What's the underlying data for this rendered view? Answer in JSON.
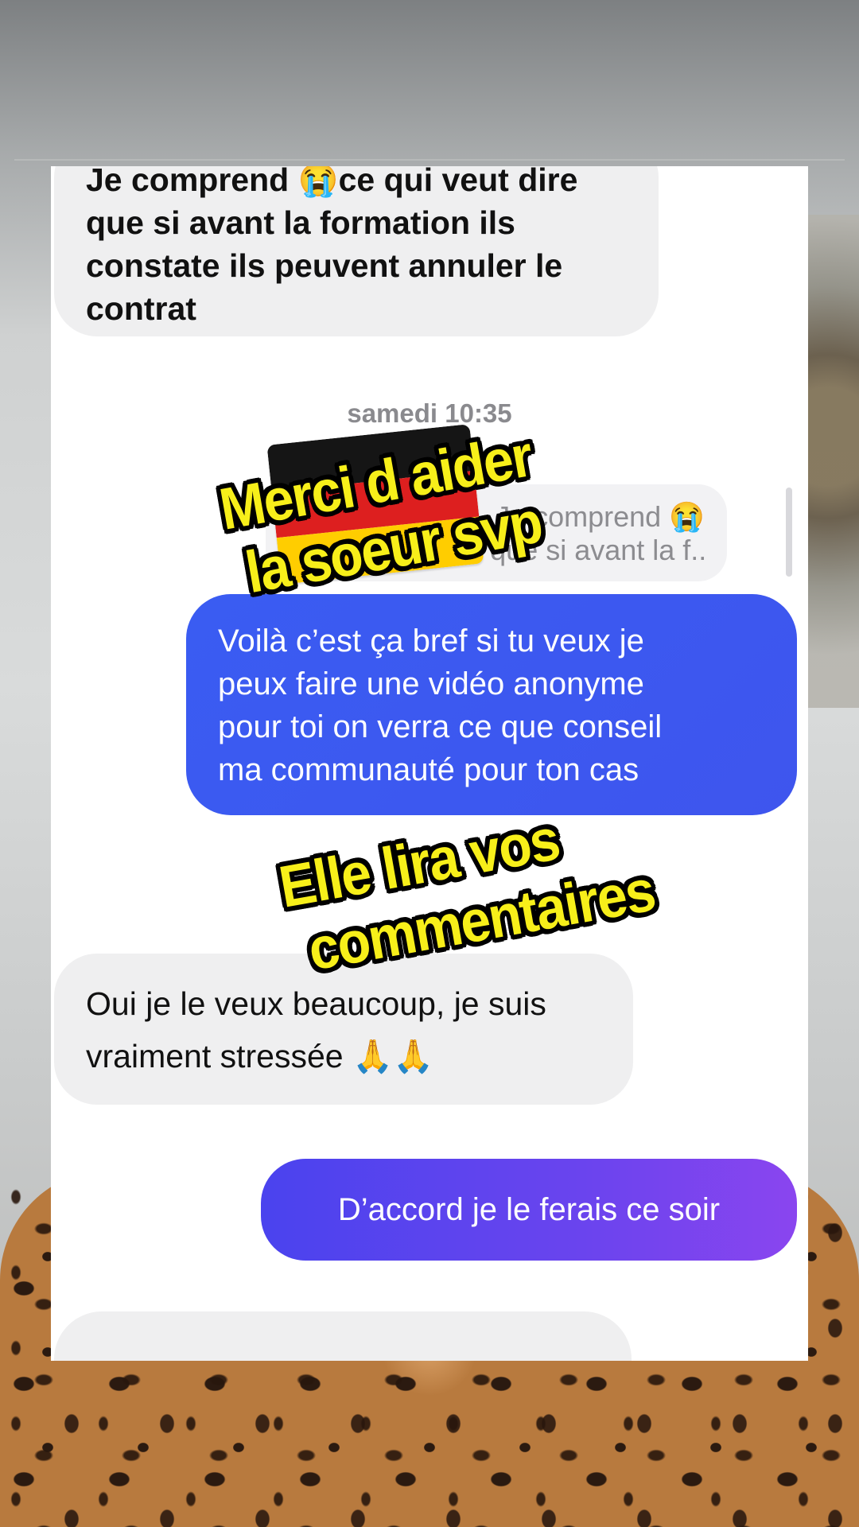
{
  "messages": {
    "msg1_lines": [
      "Je comprend 😭ce qui veut dire",
      "que si avant la formation ils",
      "constate ils peuvent annuler le",
      "contrat"
    ],
    "timestamp": "samedi 10:35",
    "quote_lines": [
      "Je comprend 😭",
      "ce qui veut dire que si avant la f..."
    ],
    "msg3_lines": [
      "Voilà c’est ça bref si tu veux je",
      "peux faire une vidéo anonyme",
      "pour toi on verra ce que conseil",
      "ma communauté pour ton cas"
    ],
    "msg4_lines": [
      "Oui je le veux beaucoup, je suis",
      "vraiment stressée 🙏🙏"
    ],
    "msg5": "D’accord je le ferais ce soir"
  },
  "overlay": {
    "caption1_lines": [
      "Merci d aider",
      "la soeur svp"
    ],
    "caption2_lines": [
      "Elle lira vos",
      "commentaires"
    ],
    "flag": "germany-flag",
    "caption_color": "#f7ef1a"
  },
  "colors": {
    "incoming_bubble": "#efeff0",
    "outgoing_blue": "#3a5cf2",
    "outgoing_purple": "#8a45ef"
  }
}
